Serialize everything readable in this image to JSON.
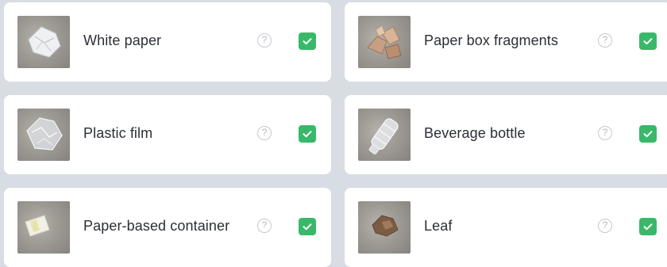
{
  "items": [
    {
      "label": "White paper",
      "help_glyph": "?",
      "checked": true,
      "thumb_icon": "white-paper-photo"
    },
    {
      "label": "Paper box fragments",
      "help_glyph": "?",
      "checked": true,
      "thumb_icon": "paper-box-photo"
    },
    {
      "label": "Plastic film",
      "help_glyph": "?",
      "checked": true,
      "thumb_icon": "plastic-film-photo"
    },
    {
      "label": "Beverage bottle",
      "help_glyph": "?",
      "checked": true,
      "thumb_icon": "bottle-photo"
    },
    {
      "label": "Paper-based container",
      "help_glyph": "?",
      "checked": true,
      "thumb_icon": "paper-container-photo"
    },
    {
      "label": "Leaf",
      "help_glyph": "?",
      "checked": true,
      "thumb_icon": "leaf-photo"
    }
  ],
  "colors": {
    "page_background": "#d8dde4",
    "card_background": "#ffffff",
    "check_green": "#3ab86a",
    "text": "#2b2f36"
  }
}
